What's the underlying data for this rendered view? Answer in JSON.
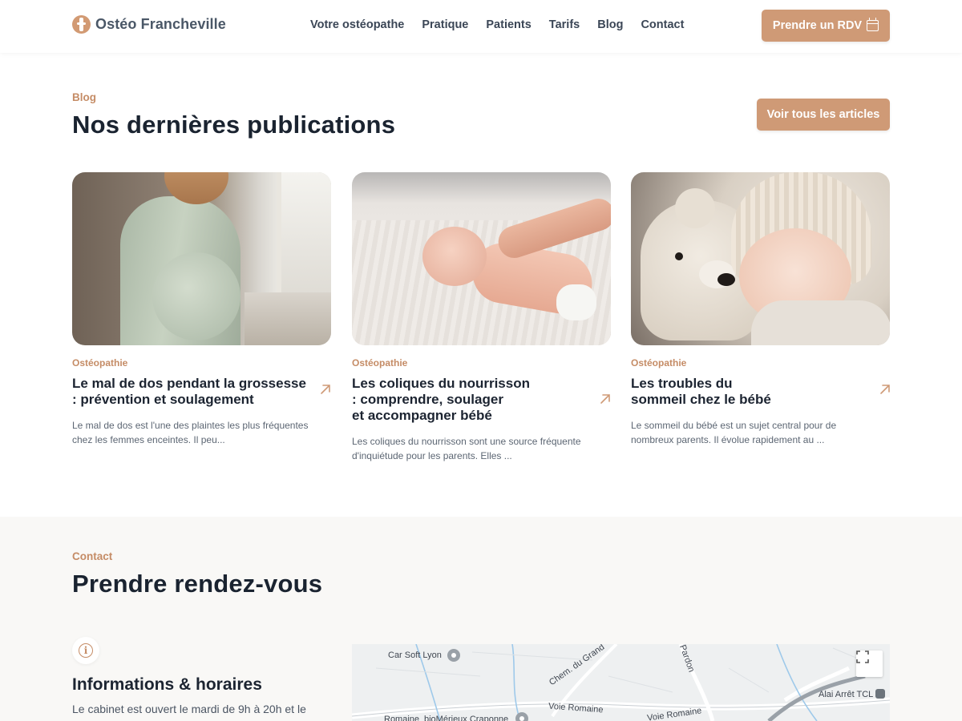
{
  "header": {
    "logo_text": "Ostéo Francheville",
    "nav": [
      "Votre ostéopathe",
      "Pratique",
      "Patients",
      "Tarifs",
      "Blog",
      "Contact"
    ],
    "cta_label": "Prendre un RDV"
  },
  "blog": {
    "eyebrow": "Blog",
    "title": "Nos dernières publications",
    "all_button": "Voir tous les articles",
    "articles": [
      {
        "category": "Ostéopathie",
        "title": "Le mal de dos pendant la grossesse\n: prévention et soulagement",
        "excerpt": "Le mal de dos est l'une des plaintes les plus fréquentes chez les femmes enceintes. Il peu..."
      },
      {
        "category": "Ostéopathie",
        "title": "Les coliques du nourrisson\n: comprendre, soulager\net accompagner bébé",
        "excerpt": "Les coliques du nourrisson sont une source fréquente d'inquiétude pour les parents. Elles ..."
      },
      {
        "category": "Ostéopathie",
        "title": "Les troubles du\nsommeil chez le bébé",
        "excerpt": "Le sommeil du bébé est un sujet central pour de nombreux parents. Il évolue rapidement au ..."
      }
    ]
  },
  "contact": {
    "eyebrow": "Contact",
    "title": "Prendre rendez-vous",
    "info_title": "Informations & horaires",
    "info_text": "Le cabinet est ouvert le mardi de 9h à 20h et le"
  },
  "map": {
    "labels": [
      "Car Soft Lyon",
      "Chem. du Grand",
      "Pardon",
      "Alai Arrêt TCL",
      "Voie Romaine",
      "Voie Romaine",
      "Romaine",
      "bioMérieux Craponne"
    ]
  },
  "colors": {
    "accent": "#cf9a76",
    "eyebrow": "#c58c66",
    "text_dark": "#1a2330",
    "section_bg": "#f9f8f6"
  }
}
